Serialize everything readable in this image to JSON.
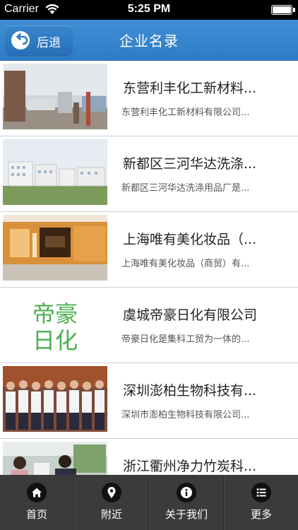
{
  "status_bar": {
    "carrier": "Carrier",
    "time": "5:25 PM"
  },
  "navbar": {
    "back_label": "后退",
    "title": "企业名录"
  },
  "list": [
    {
      "title": "东营利丰化工新材料...",
      "description": "东营利丰化工新材料有限公司..."
    },
    {
      "title": "新都区三河华达洗涤...",
      "description": "新都区三河华达洗涤用品厂是..."
    },
    {
      "title": "上海唯有美化妆品（...",
      "description": "上海唯有美化妆品（商贸）有..."
    },
    {
      "title": "虞城帝豪日化有限公司",
      "description": "帝豪日化是集科工贸为一体的...",
      "logo_text": "帝豪日化"
    },
    {
      "title": "深圳澎柏生物科技有...",
      "description": "深圳市澎柏生物科技有限公司..."
    },
    {
      "title": "浙江衢州净力竹炭科...",
      "description": ""
    }
  ],
  "tabbar": {
    "tabs": [
      {
        "label": "首页",
        "icon": "home-icon"
      },
      {
        "label": "附近",
        "icon": "location-pin-icon"
      },
      {
        "label": "关于我们",
        "icon": "info-icon"
      },
      {
        "label": "更多",
        "icon": "more-list-icon"
      }
    ]
  },
  "colors": {
    "navbar": "#3584cc",
    "tabbar": "#3b3b3b",
    "logo_green": "#4caf50"
  }
}
